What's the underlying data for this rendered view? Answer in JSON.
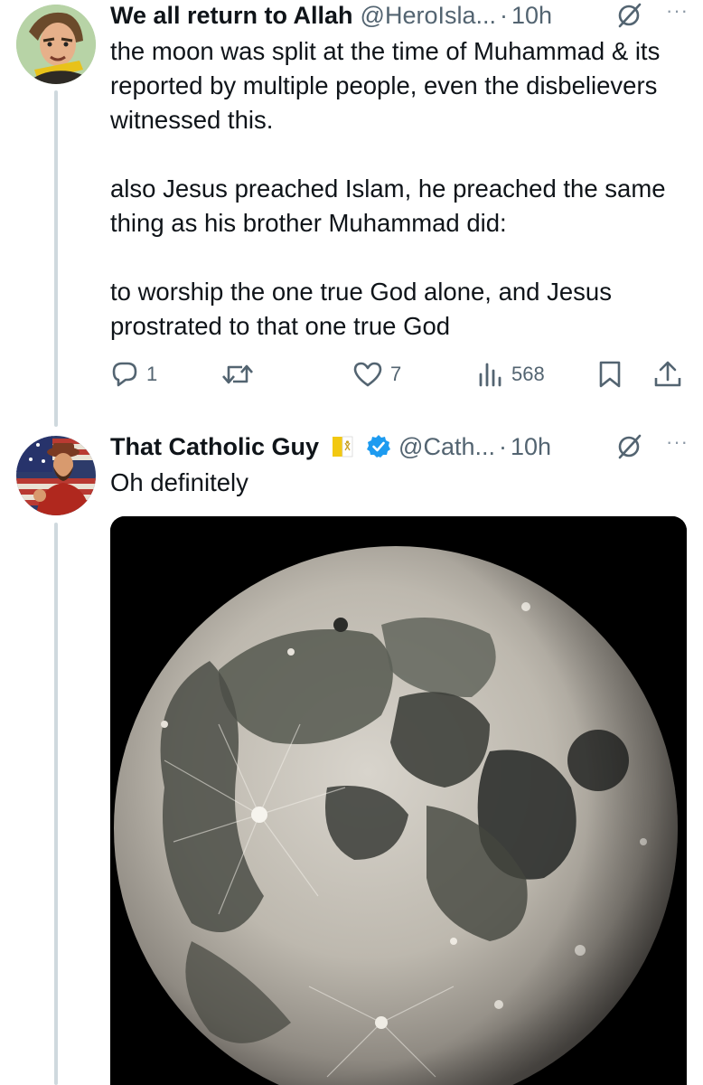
{
  "tweets": [
    {
      "display_name": "We all return to Allah",
      "handle": "@HeroIsla...",
      "dot": "·",
      "time": "10h",
      "more": "···",
      "paragraphs": [
        "the moon was split at the time of Muhammad & its reported by multiple people, even the disbelievers witnessed this.",
        "also Jesus preached Islam, he preached the same thing as his brother Muhammad did:",
        "to worship the one true God alone, and Jesus prostrated to that one true God"
      ],
      "actions": {
        "replies": "1",
        "retweets": "",
        "likes": "7",
        "views": "568"
      }
    },
    {
      "display_name": "That Catholic Guy",
      "flag_icon": "vatican-flag-icon",
      "verified": true,
      "verified_color": "#1d9bf0",
      "handle": "@Cath...",
      "dot": "·",
      "time": "10h",
      "more": "···",
      "text": "Oh definitely",
      "media": "full-moon-photo"
    }
  ],
  "colors": {
    "text": "#0f1419",
    "secondary": "#536471",
    "thread_line": "#cfd9de",
    "accent": "#1d9bf0"
  }
}
